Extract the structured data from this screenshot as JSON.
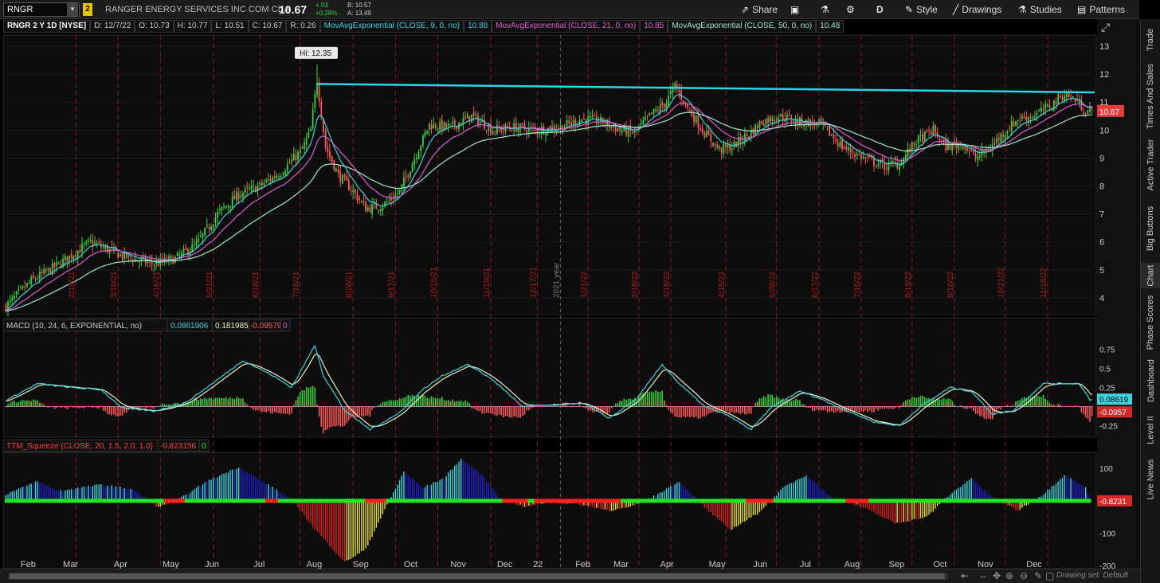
{
  "toolbar": {
    "symbol": "RNGR",
    "link_badge": "2",
    "company": "RANGER ENERGY SERVICES INC COM CL A",
    "last": "10.67",
    "change": "+.03",
    "change_pct": "+0.28%",
    "bid": "B: 10.57",
    "ask": "A: 13.49",
    "share": "Share",
    "aggregation": "D",
    "style": "Style",
    "drawings": "Drawings",
    "studies": "Studies",
    "patterns": "Patterns"
  },
  "header": {
    "symbol_desc": "RNGR 2 Y 1D [NYSE]",
    "d": "D: 12/7/22",
    "o": "O: 10.73",
    "h": "H: 10.77",
    "l": "L: 10.51",
    "c": "C: 10.67",
    "r": "R: 0.26",
    "ma9_label": "MovAvgExponential (CLOSE, 9, 0, no)",
    "ma9_val": "10.88",
    "ma21_label": "MovAvgExponential (CLOSE, 21, 0, no)",
    "ma21_val": "10.85",
    "ma50_label": "MovAvgExponential (CLOSE, 50, 0, no)",
    "ma50_val": "10.48"
  },
  "macd_header": {
    "label": "MACD (10, 24, 6, EXPONENTIAL, no)",
    "value": "0.0861906",
    "avg": "0.181985",
    "diff": "-0.0957939",
    "extra": "0"
  },
  "ttm_header": {
    "label": "TTM_Squeeze (CLOSE, 20, 1.5, 2.0, 1.0)",
    "value": "-0.823156",
    "extra": "0"
  },
  "right_tabs": [
    "Trade",
    "Times And Sales",
    "Active Trader",
    "Big Buttons",
    "Chart",
    "Phase Scores",
    "Dashboard",
    "Level II",
    "Live News"
  ],
  "bottom": {
    "drawing_set": "Drawing set: Default"
  },
  "colors": {
    "up": "#3ecf3e",
    "down": "#ff5a5a",
    "ma9": "#3fd5e0",
    "ma21": "#e05cd8",
    "ma50": "#9ee8c8",
    "trendline": "#27d7e6",
    "macd": "#3fd5e0",
    "signal": "#f0f0c0",
    "ttm_pos_up": "#3fd5e0",
    "ttm_pos_dn": "#2020c8",
    "ttm_neg_dn": "#e02020",
    "ttm_neg_up": "#e8e040",
    "squeeze_on": "#ff2020",
    "squeeze_off": "#22e822"
  },
  "chart_data": [
    {
      "type": "candlestick",
      "title": "RNGR 2 Y 1D [NYSE]",
      "y_axis_ticks": [
        4,
        5,
        6,
        7,
        8,
        9,
        10,
        11,
        12,
        13
      ],
      "ylim": [
        3.4,
        13.4
      ],
      "x_month_labels": [
        "Feb",
        "Mar",
        "Apr",
        "May",
        "Jun",
        "Jul",
        "Aug",
        "Sep",
        "Oct",
        "Nov",
        "Dec",
        "22",
        "Feb",
        "Mar",
        "Apr",
        "May",
        "Jun",
        "Jul",
        "Aug",
        "Sep",
        "Oct",
        "Nov",
        "Dec"
      ],
      "x_month_label_idx": [
        10,
        30,
        54,
        77,
        97,
        120,
        145,
        167,
        191,
        213,
        235,
        252,
        272,
        290,
        312,
        335,
        356,
        378,
        399,
        420,
        441,
        462,
        485
      ],
      "vertical_date_labels": [
        "2/19/21",
        "3/19/21",
        "4/16/21",
        "5/21/21",
        "6/18/21",
        "7/16/21",
        "8/20/21",
        "9/17/21",
        "10/15/21",
        "11/19/21",
        "12/17/21",
        "1/21/22",
        "2/18/22",
        "3/18/22",
        "4/15/22",
        "5/20/22",
        "6/17/22",
        "7/15/22",
        "8/19/22",
        "9/16/22",
        "10/21/22",
        "11/18/22"
      ],
      "vertical_date_idx": [
        33,
        53,
        73,
        98,
        120,
        139,
        164,
        184,
        204,
        229,
        251,
        275,
        299,
        314,
        340,
        364,
        384,
        404,
        428,
        448,
        472,
        492
      ],
      "year_label": "2021 year",
      "year_label_idx": 262,
      "hi_label": "Hi: 12.35",
      "hi_idx": 147,
      "hi_value": 12.35,
      "last_label": "10.67",
      "last_value": 10.67,
      "trendline": {
        "from_idx": 147,
        "from_value": 11.65,
        "to_idx": 512,
        "to_value": 11.35
      },
      "price_keypoints": [
        [
          0,
          3.7
        ],
        [
          12,
          4.6
        ],
        [
          25,
          5.2
        ],
        [
          40,
          6.0
        ],
        [
          55,
          5.5
        ],
        [
          70,
          5.2
        ],
        [
          80,
          5.4
        ],
        [
          90,
          5.9
        ],
        [
          100,
          7.0
        ],
        [
          110,
          7.7
        ],
        [
          120,
          8.0
        ],
        [
          130,
          8.5
        ],
        [
          140,
          9.3
        ],
        [
          144,
          10.0
        ],
        [
          147,
          11.8
        ],
        [
          151,
          9.4
        ],
        [
          157,
          8.4
        ],
        [
          163,
          7.9
        ],
        [
          170,
          7.2
        ],
        [
          178,
          7.3
        ],
        [
          186,
          7.8
        ],
        [
          193,
          9.0
        ],
        [
          200,
          10.2
        ],
        [
          210,
          10.1
        ],
        [
          220,
          10.5
        ],
        [
          230,
          10.0
        ],
        [
          240,
          10.1
        ],
        [
          250,
          10.0
        ],
        [
          262,
          10.1
        ],
        [
          272,
          10.4
        ],
        [
          282,
          10.3
        ],
        [
          290,
          10.0
        ],
        [
          297,
          9.9
        ],
        [
          304,
          10.5
        ],
        [
          312,
          11.0
        ],
        [
          316,
          11.6
        ],
        [
          322,
          10.8
        ],
        [
          330,
          9.9
        ],
        [
          337,
          9.3
        ],
        [
          343,
          9.4
        ],
        [
          350,
          9.8
        ],
        [
          357,
          10.3
        ],
        [
          365,
          10.5
        ],
        [
          375,
          10.3
        ],
        [
          385,
          10.2
        ],
        [
          395,
          9.4
        ],
        [
          405,
          9.0
        ],
        [
          415,
          8.7
        ],
        [
          422,
          8.8
        ],
        [
          430,
          9.6
        ],
        [
          438,
          10.0
        ],
        [
          444,
          9.4
        ],
        [
          452,
          9.5
        ],
        [
          458,
          9.0
        ],
        [
          464,
          9.3
        ],
        [
          470,
          9.8
        ],
        [
          478,
          10.4
        ],
        [
          485,
          10.5
        ],
        [
          492,
          10.8
        ],
        [
          500,
          11.3
        ],
        [
          505,
          11.1
        ],
        [
          510,
          10.67
        ]
      ]
    },
    {
      "type": "line",
      "title": "MACD (10, 24, 6, EXPONENTIAL, no)",
      "y_axis_ticks": [
        -0.25,
        0,
        0.25,
        0.5,
        0.75
      ],
      "ylim": [
        -0.4,
        0.95
      ],
      "value_label": "0.08619",
      "diff_label": "-0.0957",
      "last_value": 0.08619,
      "last_diff": -0.0957,
      "macd_keypoints": [
        [
          0,
          0.08
        ],
        [
          15,
          0.3
        ],
        [
          30,
          0.25
        ],
        [
          45,
          0.22
        ],
        [
          55,
          -0.02
        ],
        [
          70,
          -0.06
        ],
        [
          85,
          0.05
        ],
        [
          100,
          0.35
        ],
        [
          112,
          0.6
        ],
        [
          125,
          0.42
        ],
        [
          135,
          0.25
        ],
        [
          142,
          0.6
        ],
        [
          146,
          0.8
        ],
        [
          150,
          0.4
        ],
        [
          160,
          -0.05
        ],
        [
          172,
          -0.3
        ],
        [
          185,
          -0.1
        ],
        [
          196,
          0.2
        ],
        [
          206,
          0.4
        ],
        [
          218,
          0.55
        ],
        [
          230,
          0.35
        ],
        [
          244,
          0.0
        ],
        [
          258,
          0.02
        ],
        [
          272,
          0.05
        ],
        [
          285,
          -0.15
        ],
        [
          298,
          0.1
        ],
        [
          310,
          0.55
        ],
        [
          318,
          0.3
        ],
        [
          330,
          0.0
        ],
        [
          340,
          -0.1
        ],
        [
          352,
          -0.3
        ],
        [
          362,
          0.0
        ],
        [
          375,
          0.2
        ],
        [
          385,
          0.1
        ],
        [
          395,
          -0.03
        ],
        [
          410,
          -0.2
        ],
        [
          422,
          -0.25
        ],
        [
          432,
          0.0
        ],
        [
          446,
          0.25
        ],
        [
          456,
          0.2
        ],
        [
          466,
          -0.1
        ],
        [
          476,
          -0.05
        ],
        [
          490,
          0.3
        ],
        [
          502,
          0.3
        ],
        [
          507,
          0.3
        ],
        [
          512,
          0.09
        ]
      ]
    },
    {
      "type": "bar",
      "title": "TTM_Squeeze (CLOSE, 20, 1.5, 2.0, 1.0)",
      "y_axis_ticks": [
        100,
        0,
        -100,
        -200
      ],
      "ylim": [
        -210,
        140
      ],
      "value_label": "-0.8231",
      "last_value": -0.8231,
      "ttm_keypoints": [
        [
          0,
          20
        ],
        [
          15,
          60
        ],
        [
          25,
          30
        ],
        [
          45,
          50
        ],
        [
          60,
          35
        ],
        [
          72,
          -20
        ],
        [
          82,
          5
        ],
        [
          95,
          60
        ],
        [
          110,
          105
        ],
        [
          125,
          45
        ],
        [
          135,
          5
        ],
        [
          145,
          -80
        ],
        [
          160,
          -190
        ],
        [
          170,
          -150
        ],
        [
          178,
          -40
        ],
        [
          188,
          90
        ],
        [
          197,
          40
        ],
        [
          207,
          70
        ],
        [
          215,
          130
        ],
        [
          225,
          80
        ],
        [
          233,
          10
        ],
        [
          245,
          -20
        ],
        [
          255,
          -5
        ],
        [
          270,
          -10
        ],
        [
          285,
          -30
        ],
        [
          295,
          -20
        ],
        [
          305,
          10
        ],
        [
          318,
          60
        ],
        [
          330,
          -20
        ],
        [
          342,
          -90
        ],
        [
          355,
          -40
        ],
        [
          368,
          45
        ],
        [
          378,
          80
        ],
        [
          390,
          10
        ],
        [
          405,
          -20
        ],
        [
          420,
          -70
        ],
        [
          435,
          -50
        ],
        [
          446,
          20
        ],
        [
          456,
          70
        ],
        [
          466,
          10
        ],
        [
          478,
          -30
        ],
        [
          490,
          20
        ],
        [
          500,
          80
        ],
        [
          510,
          40
        ],
        [
          513,
          -1
        ]
      ],
      "squeeze_on_ranges": [
        [
          75,
          84
        ],
        [
          123,
          126
        ],
        [
          127,
          128
        ],
        [
          170,
          179
        ],
        [
          235,
          246
        ],
        [
          250,
          290
        ],
        [
          350,
          362
        ],
        [
          397,
          405
        ],
        [
          406,
          407
        ]
      ]
    }
  ]
}
